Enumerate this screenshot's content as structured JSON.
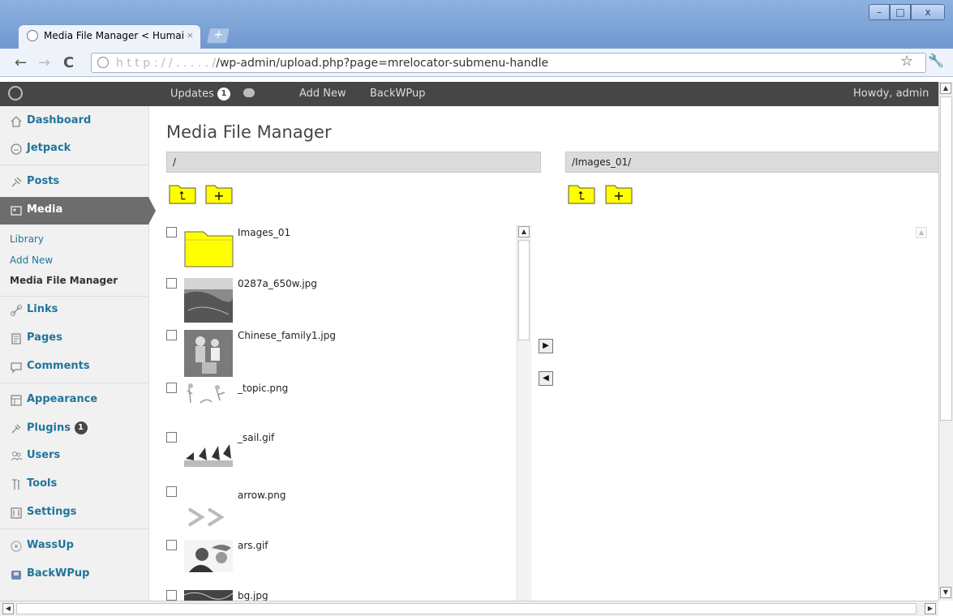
{
  "browser": {
    "tab_title": "Media File Manager < Humai",
    "tab_close": "×",
    "new_tab": "+",
    "url_faded": "h t t p : / / . . . . . /",
    "url_path": "/wp-admin/upload.php?page=mrelocator-submenu-handle",
    "window_buttons": {
      "minimize": "–",
      "maximize": "□",
      "close": "x"
    },
    "nav": {
      "back": "←",
      "forward": "→",
      "reload": "C",
      "star": "☆",
      "wrench": "🔧"
    }
  },
  "adminbar": {
    "updates_label": "Updates",
    "updates_count": "1",
    "add_new": "Add New",
    "backwpup": "BackWPup",
    "howdy": "Howdy, admin"
  },
  "sidebar": {
    "dashboard": "Dashboard",
    "jetpack": "Jetpack",
    "posts": "Posts",
    "media": "Media",
    "media_sub": [
      "Library",
      "Add New",
      "Media File Manager"
    ],
    "links": "Links",
    "pages": "Pages",
    "comments": "Comments",
    "appearance": "Appearance",
    "plugins": "Plugins",
    "plugins_count": "1",
    "users": "Users",
    "tools": "Tools",
    "settings": "Settings",
    "wassup": "WassUp",
    "backwpup": "BackWPup"
  },
  "main": {
    "title": "Media File Manager",
    "left_path": "/",
    "right_path": "/Images_01/",
    "up_folder_glyph": "⮤",
    "new_folder_glyph": "+",
    "move_right": "▶",
    "move_left": "◀",
    "files": [
      {
        "name": "Images_01",
        "kind": "folder"
      },
      {
        "name": "0287a_650w.jpg",
        "kind": "photo"
      },
      {
        "name": "Chinese_family1.jpg",
        "kind": "photo"
      },
      {
        "name": "_topic.png",
        "kind": "sketch"
      },
      {
        "name": "_sail.gif",
        "kind": "sail"
      },
      {
        "name": "arrow.png",
        "kind": "arrow"
      },
      {
        "name": "ars.gif",
        "kind": "photo"
      },
      {
        "name": "bg.jpg",
        "kind": "photo"
      }
    ]
  },
  "colors": {
    "adminbar": "#464646",
    "link": "#21759b",
    "folder": "#ffff00",
    "active_menu": "#6d6d6d"
  }
}
